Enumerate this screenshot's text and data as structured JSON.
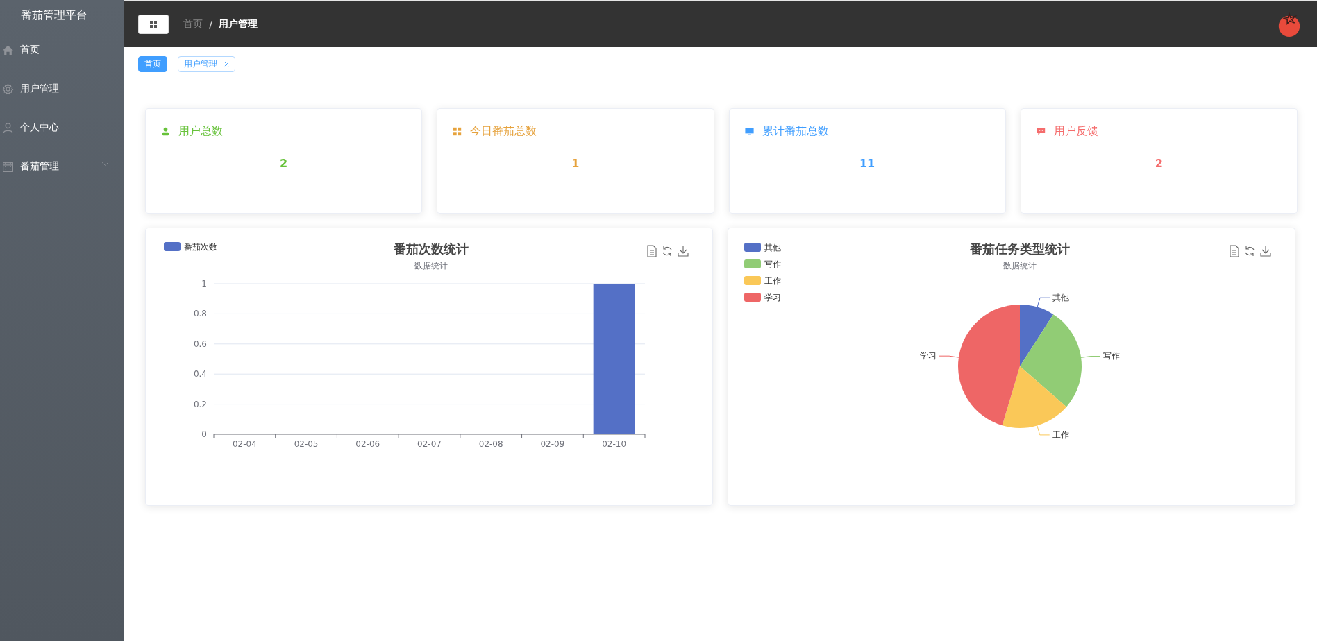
{
  "sidebar": {
    "title": "番茄管理平台",
    "items": [
      {
        "label": "首页",
        "kind": "home"
      },
      {
        "label": "用户管理",
        "kind": "gear"
      },
      {
        "label": "个人中心",
        "kind": "person"
      },
      {
        "label": "番茄管理",
        "kind": "calendar",
        "has_submenu": true
      }
    ]
  },
  "header": {
    "breadcrumb": [
      {
        "label": "首页",
        "current": false
      },
      {
        "label": "用户管理",
        "current": true
      }
    ],
    "separator": "/"
  },
  "tags": [
    {
      "label": "首页",
      "selected": true,
      "closable": false
    },
    {
      "label": "用户管理",
      "selected": false,
      "closable": true
    }
  ],
  "stats": [
    {
      "label": "用户总数",
      "value": "2",
      "color": "#67c23a",
      "kind": "user"
    },
    {
      "label": "今日番茄总数",
      "value": "1",
      "color": "#e6a23c",
      "kind": "grid"
    },
    {
      "label": "累计番茄总数",
      "value": "11",
      "color": "#409eff",
      "kind": "monitor"
    },
    {
      "label": "用户反馈",
      "value": "2",
      "color": "#f56c6c",
      "kind": "chat"
    }
  ],
  "bar_panel": {
    "chart_data": {
      "type": "bar",
      "title": "番茄次数统计",
      "subtitle": "数据统计",
      "categories": [
        "02-04",
        "02-05",
        "02-06",
        "02-07",
        "02-08",
        "02-09",
        "02-10"
      ],
      "legend": "top-left",
      "grid": true,
      "series": [
        {
          "name": "番茄次数",
          "color": "#5470c6",
          "values": [
            0,
            0,
            0,
            0,
            0,
            0,
            1
          ]
        }
      ],
      "ylim": [
        0,
        1
      ],
      "yticks": [
        0,
        {
          "value": 0.2,
          "label": "0.2"
        },
        {
          "value": 0.4,
          "label": "0.4"
        },
        {
          "value": 0.6,
          "label": "0.6"
        },
        {
          "value": 0.8,
          "label": "0.8"
        },
        1
      ]
    }
  },
  "pie_panel": {
    "chart_data": {
      "type": "pie",
      "title": "番茄任务类型统计",
      "subtitle": "数据统计",
      "categories": [
        "其他",
        "写作",
        "工作",
        "学习"
      ],
      "legend": "top-left",
      "values": [
        9.1,
        27.3,
        18.2,
        45.4
      ],
      "colors": [
        "#5470c6",
        "#91cc75",
        "#fac858",
        "#ee6666"
      ]
    }
  }
}
